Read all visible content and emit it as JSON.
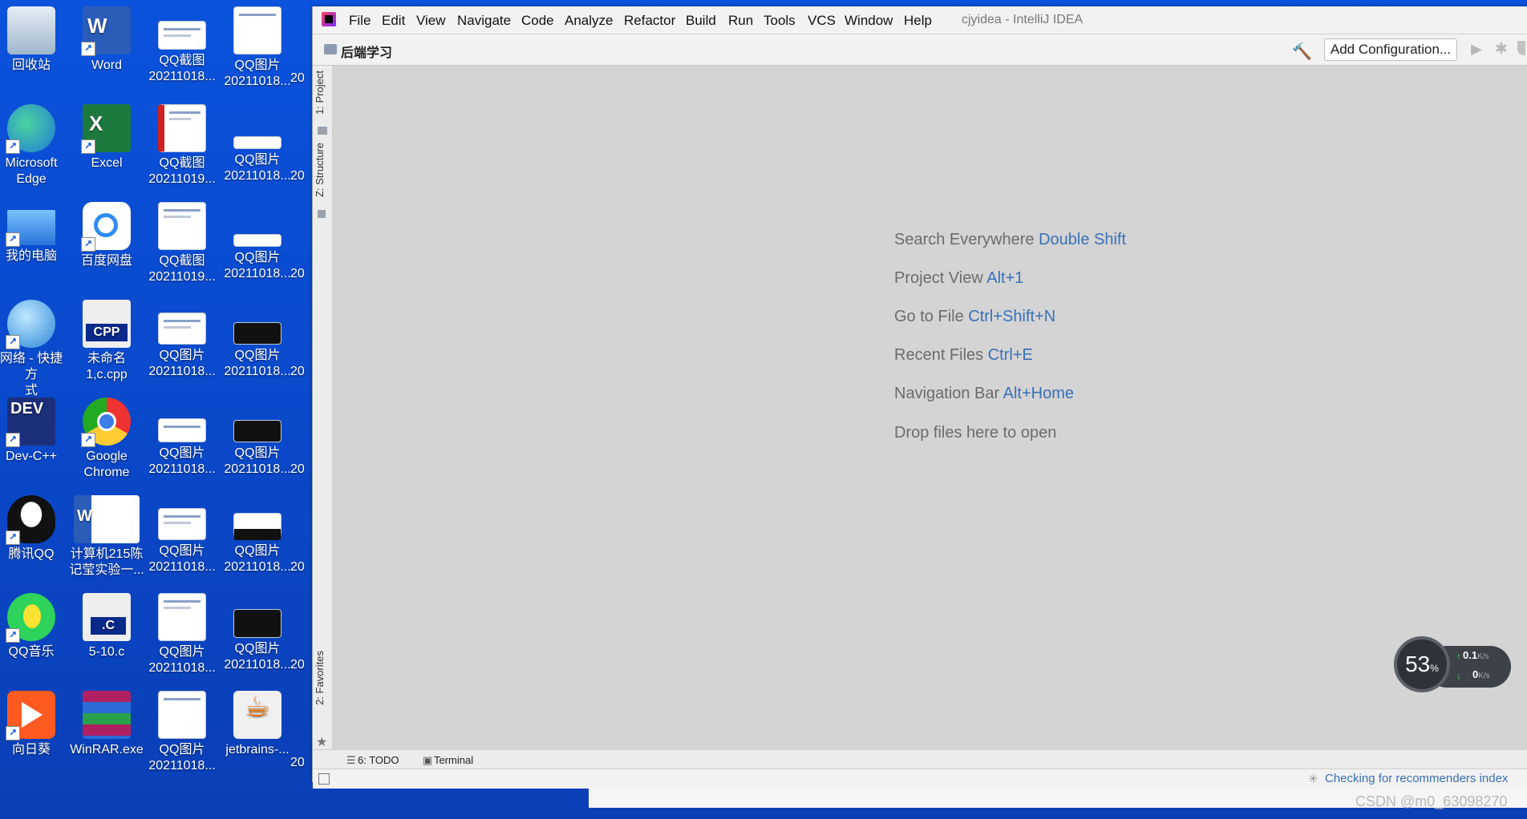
{
  "desktop": {
    "icons": [
      {
        "label": "回收站"
      },
      {
        "label": "Word"
      },
      {
        "label": "QQ截图\n20211018..."
      },
      {
        "label": "QQ图片\n20211018..."
      },
      {
        "label": "Microsoft\nEdge"
      },
      {
        "label": "Excel"
      },
      {
        "label": "QQ截图\n20211019..."
      },
      {
        "label": "QQ图片\n20211018..."
      },
      {
        "label": "我的电脑"
      },
      {
        "label": "百度网盘"
      },
      {
        "label": "QQ截图\n20211019..."
      },
      {
        "label": "QQ图片\n20211018..."
      },
      {
        "label": "网络 - 快捷方\n式"
      },
      {
        "label": "未命名\n1,c.cpp"
      },
      {
        "label": "QQ图片\n20211018..."
      },
      {
        "label": "QQ图片\n20211018..."
      },
      {
        "label": "Dev-C++"
      },
      {
        "label": "Google\nChrome"
      },
      {
        "label": "QQ图片\n20211018..."
      },
      {
        "label": "QQ图片\n20211018..."
      },
      {
        "label": "腾讯QQ"
      },
      {
        "label": "计算机215陈\n记莹实验一..."
      },
      {
        "label": "QQ图片\n20211018..."
      },
      {
        "label": "QQ图片\n20211018..."
      },
      {
        "label": "QQ音乐"
      },
      {
        "label": "5-10.c"
      },
      {
        "label": "QQ图片\n20211018..."
      },
      {
        "label": "QQ图片\n20211018..."
      },
      {
        "label": "向日葵"
      },
      {
        "label": "WinRAR.exe"
      },
      {
        "label": "QQ图片\n20211018..."
      },
      {
        "label": "jetbrains-..."
      }
    ],
    "edge_fragments": [
      "20",
      "20",
      "20",
      "20",
      "20",
      "20",
      "20",
      "20"
    ]
  },
  "ide": {
    "menu": [
      "File",
      "Edit",
      "View",
      "Navigate",
      "Code",
      "Analyze",
      "Refactor",
      "Build",
      "Run",
      "Tools",
      "VCS",
      "Window",
      "Help"
    ],
    "window_title": "cjyidea - IntelliJ IDEA",
    "project_name": "后端学习",
    "add_configuration": "Add Configuration...",
    "side_tabs": {
      "project": "1: Project",
      "structure": "Z: Structure",
      "favorites": "2: Favorites"
    },
    "hints": [
      {
        "text": "Search Everywhere",
        "key": "Double Shift"
      },
      {
        "text": "Project View",
        "key": "Alt+1"
      },
      {
        "text": "Go to File",
        "key": "Ctrl+Shift+N"
      },
      {
        "text": "Recent Files",
        "key": "Ctrl+E"
      },
      {
        "text": "Navigation Bar",
        "key": "Alt+Home"
      },
      {
        "text": "Drop files here to open",
        "key": ""
      }
    ],
    "bottom_tabs": {
      "todo": "6: TODO",
      "terminal": "Terminal"
    },
    "status_message": "Checking for recommenders index"
  },
  "net_widget": {
    "percent": "53",
    "percent_unit": "%",
    "upload": "0.1",
    "download": "0",
    "unit": "K/s"
  },
  "watermark": "CSDN @m0_63098270",
  "icons": {
    "hammer": "hammer-icon",
    "run": "run-icon",
    "debug": "debug-icon",
    "folder": "folder-icon"
  },
  "colors": {
    "desktop_bg": "#0a4fd8",
    "ide_bg": "#d4d4d4",
    "hint_key": "#3870b8"
  }
}
